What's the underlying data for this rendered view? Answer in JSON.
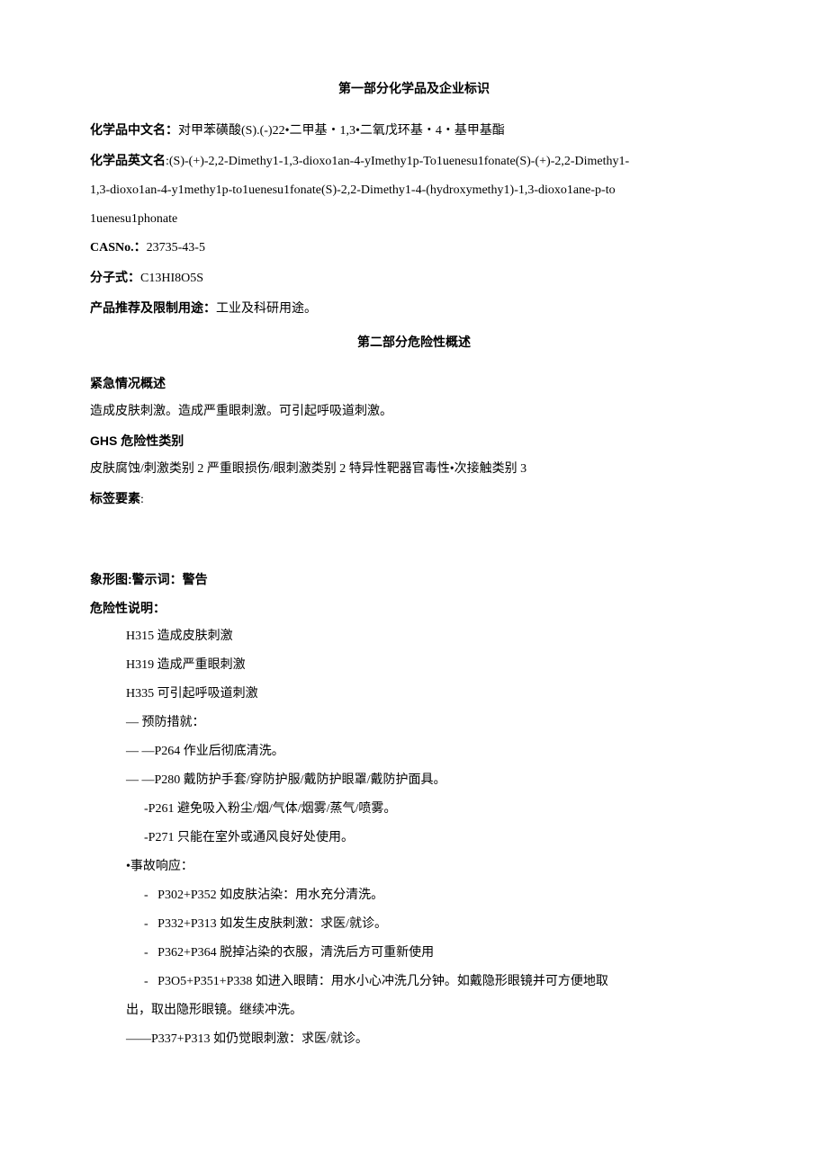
{
  "section1": {
    "title": "第一部分化学品及企业标识",
    "chineseNameLabel": "化学品中文名：",
    "chineseName": "对甲苯磺酸(S).(-)22•二甲基・1,3•二氧戊环基・4・基甲基酯",
    "englishNameLabel": "化学品英文名",
    "englishName1": ":(S)-(+)-2,2-Dimethy1-1,3-dioxo1an-4-yImethy1p-To1uenesu1fonate(S)-(+)-2,2-Dimethy1-",
    "englishName2": "1,3-dioxo1an-4-y1methy1p-to1uenesu1fonate(S)-2,2-Dimethy1-4-(hydroxymethy1)-1,3-dioxo1ane-p-to",
    "englishName3": "1uenesu1phonate",
    "casLabel": "CASNo.：",
    "cas": "23735-43-5",
    "formulaLabel": "分子式：",
    "formula": "C13HI8O5S",
    "useLabel": "产品推荐及限制用途：",
    "use": "工业及科研用途。"
  },
  "section2": {
    "title": "第二部分危险性概述",
    "emergencyLabel": "紧急情况概述",
    "emergency": "造成皮肤刺激。造成严重眼刺激。可引起呼吸道刺激。",
    "ghsLabel": "GHS 危险性类别",
    "ghs": "皮肤腐蚀/刺激类别 2 严重眼损伤/眼刺激类别 2 特异性靶器官毒性•次接触类别 3",
    "labelElementsLabel": "标签要素",
    "pictogramLabel": "象形图:警示词：警告",
    "hazardLabel": "危险性说明：",
    "h315": "H315 造成皮肤刺激",
    "h319": "H319 造成严重眼刺激",
    "h335": "H335 可引起呼吸道刺激",
    "preventionLabel": "— 预防措就：",
    "p264": "—  —P264 作业后彻底清洗。",
    "p280": "—  —P280 戴防护手套/穿防护服/戴防护眼罩/戴防护面具。",
    "p261": "-P261 避免吸入粉尘/烟/气体/烟雾/蒸气/喷雾。",
    "p271": "-P271 只能在室外或通风良好处使用。",
    "responseLabel": "•事故响应：",
    "p302": "P302+P352 如皮肤沾染：用水充分清洗。",
    "p332": "P332+P313 如发生皮肤刺激：求医/就诊。",
    "p362": "P362+P364 脱掉沾染的衣服，清洗后方可重新使用",
    "p305": "P3O5+P351+P338 如进入眼睛：用水小心冲洗几分钟。如戴隐形眼镜并可方便地取",
    "p305b": "出，取出隐形眼镜。继续冲洗。",
    "p337": "——P337+P313 如仍觉眼刺激：求医/就诊。"
  }
}
